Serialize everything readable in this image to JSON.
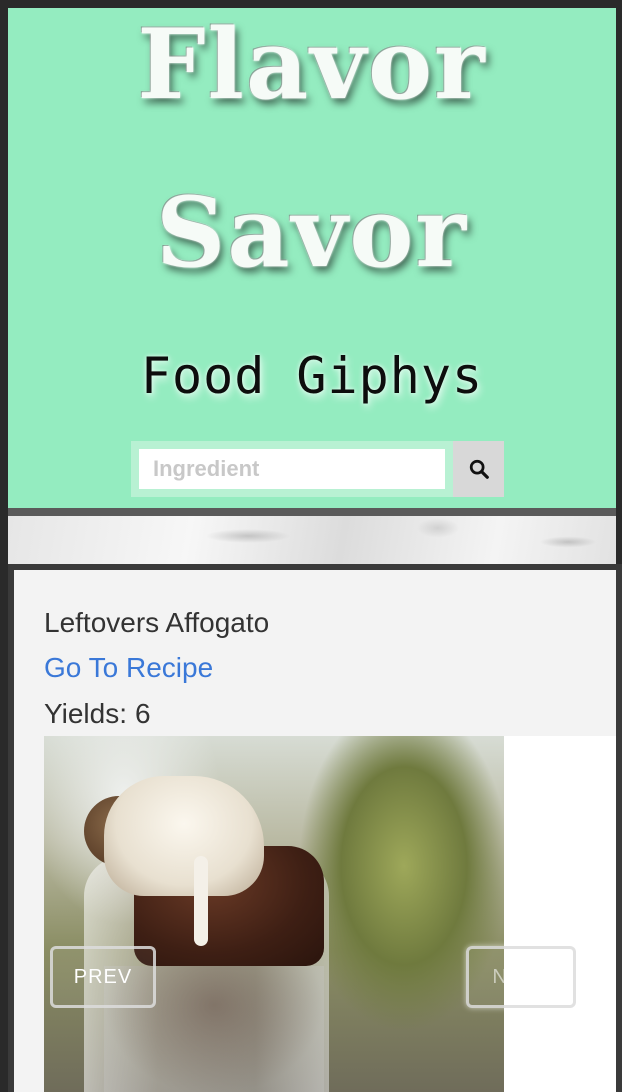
{
  "header": {
    "title_line1": "Flavor",
    "title_line2": "Savor",
    "subtitle": "Food Giphys"
  },
  "search": {
    "placeholder": "Ingredient",
    "button_icon": "search-icon"
  },
  "recipe": {
    "name": "Leftovers Affogato",
    "link_label": "Go To Recipe",
    "yields_label": "Yields:",
    "yields_value": "6"
  },
  "carousel": {
    "prev_label": "PREV",
    "next_label": "NEXT",
    "image_alt": "affogato-photo"
  },
  "colors": {
    "header_bg": "#94ecc0",
    "link": "#3a78d8",
    "card_bg": "#f3f3f3"
  }
}
